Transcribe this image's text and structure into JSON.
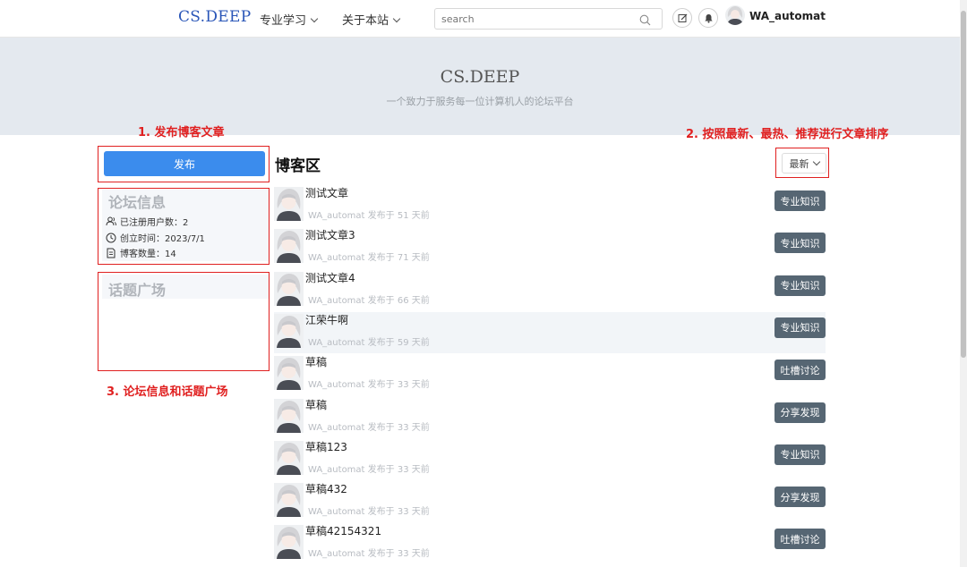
{
  "header": {
    "brand": "CS.DEEP",
    "nav": [
      {
        "label": "专业学习"
      },
      {
        "label": "关于本站"
      }
    ],
    "search_placeholder": "search",
    "username": "WA_automat"
  },
  "hero": {
    "title": "CS.DEEP",
    "subtitle": "一个致力于服务每一位计算机人的论坛平台"
  },
  "annotations": {
    "a1": "1. 发布博客文章",
    "a2": "2. 按照最新、最热、推荐进行文章排序",
    "a3": "3. 论坛信息和话题广场"
  },
  "sidebar": {
    "publish_label": "发布",
    "forum_info": {
      "title": "论坛信息",
      "users": "已注册用户数：2",
      "created": "创立时间：2023/7/1",
      "blogs": "博客数量：14"
    },
    "topics_title": "话题广场"
  },
  "main": {
    "title": "博客区",
    "sort_label": "最新",
    "posts": [
      {
        "title": "测试文章",
        "meta": "WA_automat 发布于 51 天前",
        "tag": "专业知识"
      },
      {
        "title": "测试文章3",
        "meta": "WA_automat 发布于 71 天前",
        "tag": "专业知识"
      },
      {
        "title": "测试文章4",
        "meta": "WA_automat 发布于 66 天前",
        "tag": "专业知识"
      },
      {
        "title": "江荣牛啊",
        "meta": "WA_automat 发布于 59 天前",
        "tag": "专业知识"
      },
      {
        "title": "草稿",
        "meta": "WA_automat 发布于 33 天前",
        "tag": "吐槽讨论"
      },
      {
        "title": "草稿",
        "meta": "WA_automat 发布于 33 天前",
        "tag": "分享发现"
      },
      {
        "title": "草稿123",
        "meta": "WA_automat 发布于 33 天前",
        "tag": "专业知识"
      },
      {
        "title": "草稿432",
        "meta": "WA_automat 发布于 33 天前",
        "tag": "分享发现"
      },
      {
        "title": "草稿42154321",
        "meta": "WA_automat 发布于 33 天前",
        "tag": "吐槽讨论"
      }
    ]
  }
}
